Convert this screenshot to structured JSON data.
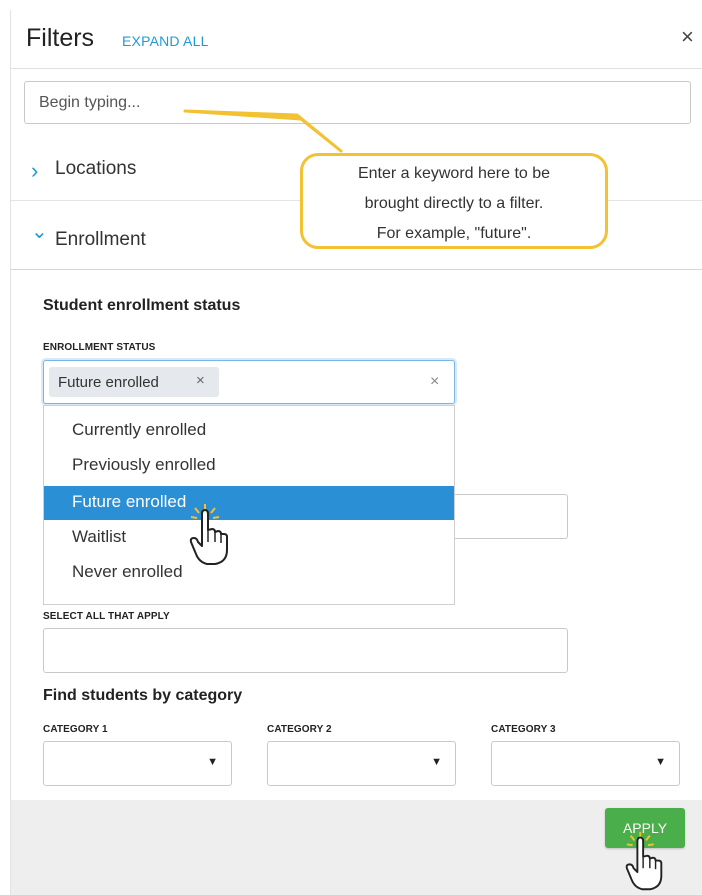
{
  "header": {
    "title": "Filters",
    "expand_all": "EXPAND ALL",
    "close_symbol": "×"
  },
  "search": {
    "placeholder": "Begin typing..."
  },
  "callout": {
    "lines": [
      "Enter a keyword here to be",
      "brought directly to a filter.",
      "For example, \"future\"."
    ]
  },
  "sections": [
    {
      "label": "Locations",
      "expanded": false,
      "chevron": "›"
    },
    {
      "label": "Enrollment",
      "expanded": true,
      "chevron": "⌄"
    }
  ],
  "enrollment": {
    "heading": "Student enrollment status",
    "status_label": "ENROLLMENT STATUS",
    "selected_tag": "Future enrolled",
    "tag_remove": "×",
    "clear": "×",
    "options": [
      {
        "label": "Currently enrolled",
        "highlighted": false
      },
      {
        "label": "Previously enrolled",
        "highlighted": false
      },
      {
        "label": "Future enrolled",
        "highlighted": true
      },
      {
        "label": "Waitlist",
        "highlighted": false
      },
      {
        "label": "Never enrolled",
        "highlighted": false
      }
    ],
    "select_all_label": "SELECT ALL THAT APPLY"
  },
  "category": {
    "heading": "Find students by category",
    "labels": [
      "CATEGORY 1",
      "CATEGORY 2",
      "CATEGORY 3"
    ],
    "arrow": "▼"
  },
  "footer": {
    "apply_label": "APPLY"
  },
  "colors": {
    "accent": "#1e9bd7",
    "selected_option": "#2b8fd6",
    "apply_button": "#4aae4a",
    "callout_border": "#f2c233"
  }
}
